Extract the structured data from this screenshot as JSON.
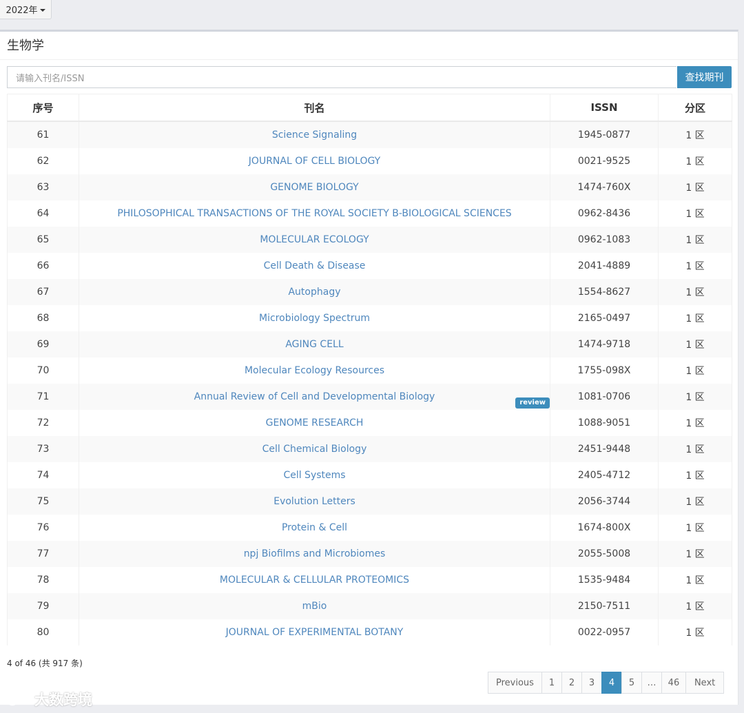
{
  "year_filter": {
    "label": "2022年"
  },
  "panel": {
    "title": "生物学"
  },
  "search": {
    "placeholder": "请输入刊名/ISSN",
    "button": "查找期刊"
  },
  "table": {
    "headers": [
      "序号",
      "刊名",
      "ISSN",
      "分区"
    ],
    "rows": [
      {
        "no": "61",
        "name": "Science Signaling",
        "issn": "1945-0877",
        "zone": "1 区"
      },
      {
        "no": "62",
        "name": "JOURNAL OF CELL BIOLOGY",
        "issn": "0021-9525",
        "zone": "1 区"
      },
      {
        "no": "63",
        "name": "GENOME BIOLOGY",
        "issn": "1474-760X",
        "zone": "1 区"
      },
      {
        "no": "64",
        "name": "PHILOSOPHICAL TRANSACTIONS OF THE ROYAL SOCIETY B-BIOLOGICAL SCIENCES",
        "issn": "0962-8436",
        "zone": "1 区"
      },
      {
        "no": "65",
        "name": "MOLECULAR ECOLOGY",
        "issn": "0962-1083",
        "zone": "1 区"
      },
      {
        "no": "66",
        "name": "Cell Death & Disease",
        "issn": "2041-4889",
        "zone": "1 区"
      },
      {
        "no": "67",
        "name": "Autophagy",
        "issn": "1554-8627",
        "zone": "1 区"
      },
      {
        "no": "68",
        "name": "Microbiology Spectrum",
        "issn": "2165-0497",
        "zone": "1 区"
      },
      {
        "no": "69",
        "name": "AGING CELL",
        "issn": "1474-9718",
        "zone": "1 区"
      },
      {
        "no": "70",
        "name": "Molecular Ecology Resources",
        "issn": "1755-098X",
        "zone": "1 区"
      },
      {
        "no": "71",
        "name": "Annual Review of Cell and Developmental Biology",
        "issn": "1081-0706",
        "zone": "1 区",
        "badge": "review"
      },
      {
        "no": "72",
        "name": "GENOME RESEARCH",
        "issn": "1088-9051",
        "zone": "1 区"
      },
      {
        "no": "73",
        "name": "Cell Chemical Biology",
        "issn": "2451-9448",
        "zone": "1 区"
      },
      {
        "no": "74",
        "name": "Cell Systems",
        "issn": "2405-4712",
        "zone": "1 区"
      },
      {
        "no": "75",
        "name": "Evolution Letters",
        "issn": "2056-3744",
        "zone": "1 区"
      },
      {
        "no": "76",
        "name": "Protein & Cell",
        "issn": "1674-800X",
        "zone": "1 区"
      },
      {
        "no": "77",
        "name": "npj Biofilms and Microbiomes",
        "issn": "2055-5008",
        "zone": "1 区"
      },
      {
        "no": "78",
        "name": "MOLECULAR & CELLULAR PROTEOMICS",
        "issn": "1535-9484",
        "zone": "1 区"
      },
      {
        "no": "79",
        "name": "mBio",
        "issn": "2150-7511",
        "zone": "1 区"
      },
      {
        "no": "80",
        "name": "JOURNAL OF EXPERIMENTAL BOTANY",
        "issn": "0022-0957",
        "zone": "1 区"
      }
    ]
  },
  "summary": "4 of 46 (共 917 条)",
  "pagination": {
    "previous": "Previous",
    "pages": [
      "1",
      "2",
      "3",
      "4",
      "5",
      "…",
      "46"
    ],
    "active": "4",
    "next": "Next"
  },
  "watermark": {
    "text": "大数跨境"
  },
  "colors": {
    "accent": "#3c8dbc",
    "link": "#4f87bd"
  }
}
